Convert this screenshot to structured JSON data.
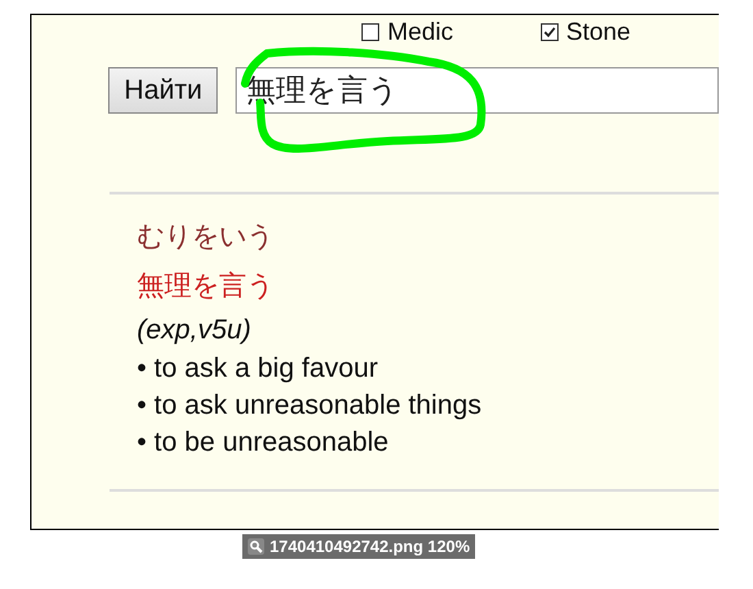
{
  "filters": [
    {
      "label": "Medic",
      "checked": false
    },
    {
      "label": "Stone",
      "checked": true
    }
  ],
  "search": {
    "button": "Найти",
    "value": "無理を言う"
  },
  "entry": {
    "reading": "むりをいう",
    "kanji": "無理を言う",
    "pos": "(exp,v5u)",
    "senses": [
      "• to ask a big favour",
      "• to ask unreasonable things",
      "• to be unreasonable"
    ]
  },
  "viewer": {
    "caption": "1740410492742.png 120%"
  }
}
